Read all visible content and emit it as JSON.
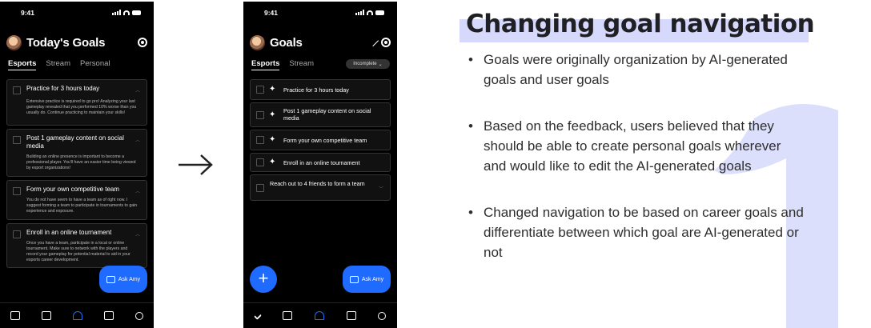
{
  "phone1": {
    "time": "9:41",
    "title": "Today's Goals",
    "tabs": [
      "Esports",
      "Stream",
      "Personal"
    ],
    "cards": [
      {
        "title": "Practice for 3 hours today",
        "desc": "Extensive practice is required to go pro! Analyzing your last gameplay revealed that you performed 10% worse than you usually do. Continue practicing to maintain your skills!"
      },
      {
        "title": "Post 1 gameplay content on social media",
        "desc": "Building an online presence is important to become a professional player. You'll have an easier time being viewed by esport organizations!"
      },
      {
        "title": "Form your own competitive team",
        "desc": "You do not have seem to have a team as of right now. I suggest forming a team to participate in tournaments to gain experience and exposure."
      },
      {
        "title": "Enroll in an online tournament",
        "desc": "Once you have a team, participate in a local or online tournament. Make sure to network with the players and record your gameplay for potential material to aid in your esports career development."
      }
    ],
    "ask_label": "Ask Amy"
  },
  "phone2": {
    "time": "9:41",
    "title": "Goals",
    "tabs": [
      "Esports",
      "Stream"
    ],
    "filter": "Incomplete",
    "goals": [
      {
        "title": "Practice for 3 hours today",
        "ai": true
      },
      {
        "title": "Post 1 gameplay content on social media",
        "ai": true
      },
      {
        "title": "Form your own competitive team",
        "ai": true
      },
      {
        "title": "Enroll in an online tournament",
        "ai": true
      },
      {
        "title": "Reach out to 4 friends to form a team",
        "ai": false
      }
    ],
    "ask_label": "Ask Amy",
    "fab_label": "+"
  },
  "slide": {
    "title": "Changing goal navigation",
    "bullets": [
      "Goals were originally organization by AI-generated goals and user goals",
      "Based on the feedback, users believed that they should be able to create personal goals wherever and would like to edit the AI-generated goals",
      "Changed navigation to be based on career goals and differentiate between which goal are AI-generated or not"
    ],
    "big_number": "1",
    "accent_color": "#d6d9fb",
    "button_color": "#1f6bff"
  }
}
